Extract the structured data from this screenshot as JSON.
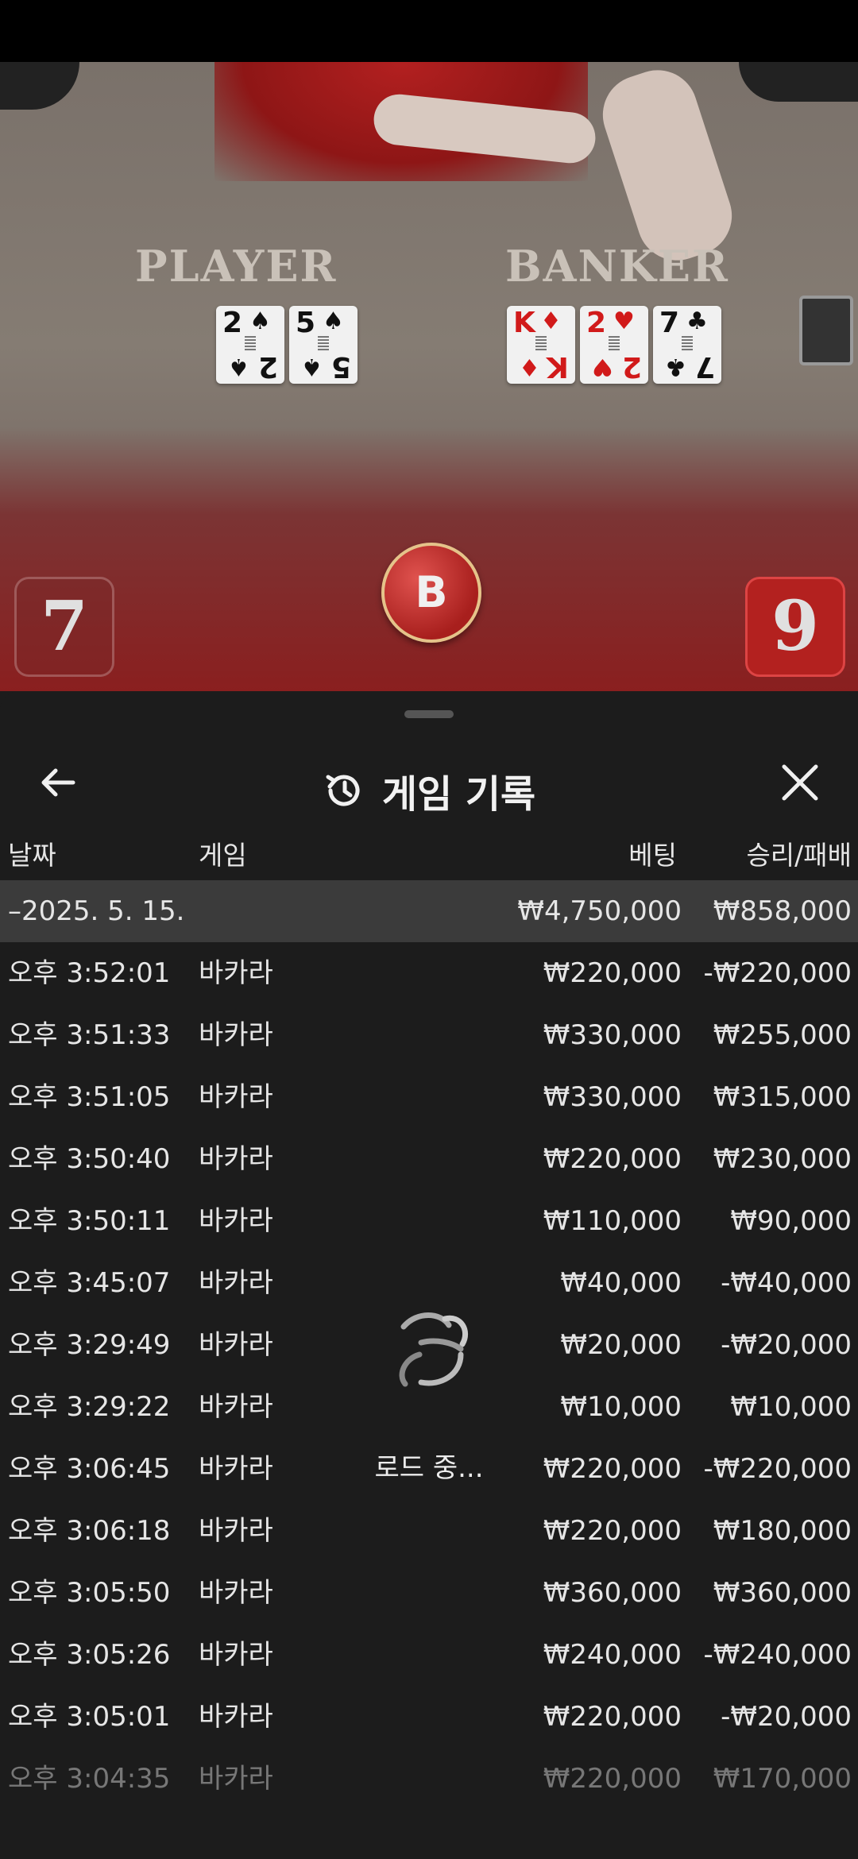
{
  "video": {
    "player_label": "PLAYER",
    "banker_label": "BANKER",
    "player_cards": [
      {
        "rank": "2",
        "suit": "♠",
        "color": "#111111"
      },
      {
        "rank": "5",
        "suit": "♠",
        "color": "#111111"
      }
    ],
    "banker_cards": [
      {
        "rank": "K",
        "suit": "♦",
        "color": "#d11a1a"
      },
      {
        "rank": "2",
        "suit": "♥",
        "color": "#d11a1a"
      },
      {
        "rank": "7",
        "suit": "♣",
        "color": "#111111"
      }
    ],
    "player_score": "7",
    "banker_score": "9",
    "winner_badge": "B"
  },
  "sheet": {
    "title": "게임 기록",
    "back_icon": "arrow-left-icon",
    "title_icon": "history-icon",
    "close_icon": "close-icon",
    "columns": {
      "date": "날짜",
      "game": "게임",
      "bet": "베팅",
      "result": "승리/패배"
    },
    "group": {
      "date": "–2025. 5. 15.",
      "bet": "₩4,750,000",
      "result": "₩858,000"
    },
    "rows": [
      {
        "time": "오후 3:52:01",
        "game": "바카라",
        "bet": "₩220,000",
        "result": "-₩220,000"
      },
      {
        "time": "오후 3:51:33",
        "game": "바카라",
        "bet": "₩330,000",
        "result": "₩255,000"
      },
      {
        "time": "오후 3:51:05",
        "game": "바카라",
        "bet": "₩330,000",
        "result": "₩315,000"
      },
      {
        "time": "오후 3:50:40",
        "game": "바카라",
        "bet": "₩220,000",
        "result": "₩230,000"
      },
      {
        "time": "오후 3:50:11",
        "game": "바카라",
        "bet": "₩110,000",
        "result": "₩90,000"
      },
      {
        "time": "오후 3:45:07",
        "game": "바카라",
        "bet": "₩40,000",
        "result": "-₩40,000"
      },
      {
        "time": "오후 3:29:49",
        "game": "바카라",
        "bet": "₩20,000",
        "result": "-₩20,000"
      },
      {
        "time": "오후 3:29:22",
        "game": "바카라",
        "bet": "₩10,000",
        "result": "₩10,000"
      },
      {
        "time": "오후 3:06:45",
        "game": "바카라",
        "bet": "₩220,000",
        "result": "-₩220,000"
      },
      {
        "time": "오후 3:06:18",
        "game": "바카라",
        "bet": "₩220,000",
        "result": "₩180,000"
      },
      {
        "time": "오후 3:05:50",
        "game": "바카라",
        "bet": "₩360,000",
        "result": "₩360,000"
      },
      {
        "time": "오후 3:05:26",
        "game": "바카라",
        "bet": "₩240,000",
        "result": "-₩240,000"
      },
      {
        "time": "오후 3:05:01",
        "game": "바카라",
        "bet": "₩220,000",
        "result": "-₩20,000"
      },
      {
        "time": "오후 3:04:35",
        "game": "바카라",
        "bet": "₩220,000",
        "result": "₩170,000"
      }
    ],
    "loading_label": "로드 중...",
    "loading_icon": "spinner-icon"
  }
}
